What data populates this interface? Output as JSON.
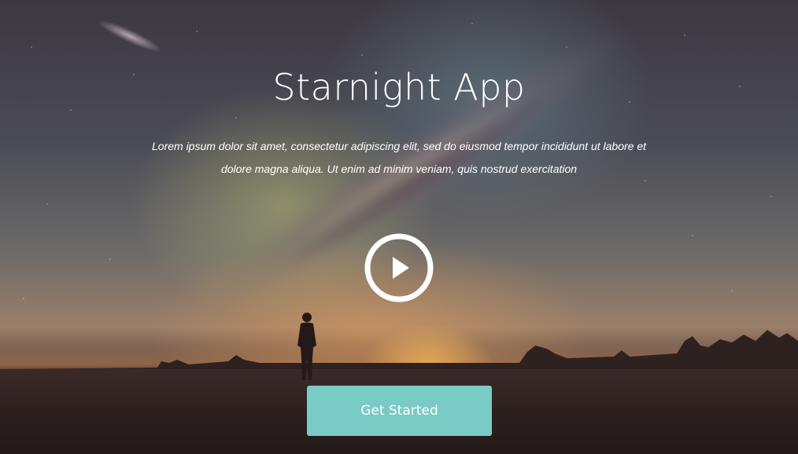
{
  "hero": {
    "title": "Starnight App",
    "subtitle": "Lorem ipsum dolor sit amet, consectetur adipiscing elit, sed do eiusmod tempor incididunt ut labore et dolore magna aliqua. Ut enim ad minim veniam, quis nostrud exercitation",
    "play_icon": "play-circle-icon",
    "cta_label": "Get Started",
    "colors": {
      "cta_background": "#79cbc6",
      "text": "#ffffff"
    }
  }
}
